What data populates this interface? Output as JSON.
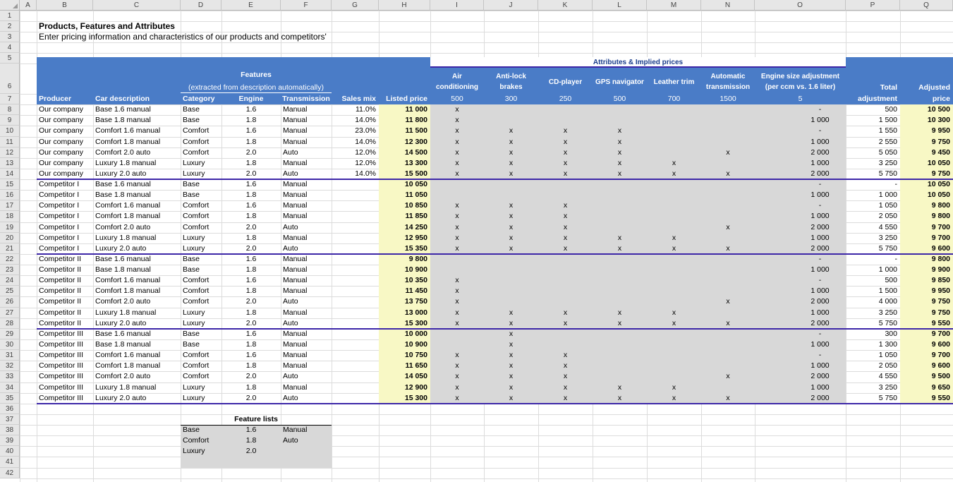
{
  "sheet": {
    "columns": [
      "A",
      "B",
      "C",
      "D",
      "E",
      "F",
      "G",
      "H",
      "I",
      "J",
      "K",
      "L",
      "M",
      "N",
      "O",
      "P",
      "Q"
    ],
    "title": "Products, Features and Attributes",
    "subtitle": "Enter pricing information and characteristics of our products and competitors'",
    "attributes_header": "Attributes & Implied prices",
    "features_header": "Features",
    "features_sub": "(extracted from description automatically)",
    "attr_headers": [
      "Air\nconditioning",
      "Anti-lock\nbrakes",
      "CD-player",
      "GPS navigator",
      "Leather trim",
      "Automatic\ntransmission",
      "Engine size adjustment\n(per ccm vs. 1.6 liter)"
    ],
    "attr_prices": [
      "500",
      "300",
      "250",
      "500",
      "700",
      "1500",
      "5"
    ],
    "total_header": "Total",
    "adjusted_header": "Adjusted",
    "col_labels": [
      "Producer",
      "Car description",
      "Category",
      "Engine",
      "Transmission",
      "Sales mix",
      "Listed price",
      "adjustment",
      "price"
    ],
    "rows": [
      [
        "Our company",
        "Base 1.6 manual",
        "Base",
        "1.6",
        "Manual",
        "11.0%",
        "11 000",
        "x",
        "",
        "",
        "",
        "",
        "",
        "-",
        "500",
        "10 500"
      ],
      [
        "Our company",
        "Base 1.8 manual",
        "Base",
        "1.8",
        "Manual",
        "14.0%",
        "11 800",
        "x",
        "",
        "",
        "",
        "",
        "",
        "1 000",
        "1 500",
        "10 300"
      ],
      [
        "Our company",
        "Comfort 1.6 manual",
        "Comfort",
        "1.6",
        "Manual",
        "23.0%",
        "11 500",
        "x",
        "x",
        "x",
        "x",
        "",
        "",
        "-",
        "1 550",
        "9 950"
      ],
      [
        "Our company",
        "Comfort 1.8 manual",
        "Comfort",
        "1.8",
        "Manual",
        "14.0%",
        "12 300",
        "x",
        "x",
        "x",
        "x",
        "",
        "",
        "1 000",
        "2 550",
        "9 750"
      ],
      [
        "Our company",
        "Comfort 2.0 auto",
        "Comfort",
        "2.0",
        "Auto",
        "12.0%",
        "14 500",
        "x",
        "x",
        "x",
        "x",
        "",
        "x",
        "2 000",
        "5 050",
        "9 450"
      ],
      [
        "Our company",
        "Luxury 1.8 manual",
        "Luxury",
        "1.8",
        "Manual",
        "12.0%",
        "13 300",
        "x",
        "x",
        "x",
        "x",
        "x",
        "",
        "1 000",
        "3 250",
        "10 050"
      ],
      [
        "Our company",
        "Luxury 2.0 auto",
        "Luxury",
        "2.0",
        "Auto",
        "14.0%",
        "15 500",
        "x",
        "x",
        "x",
        "x",
        "x",
        "x",
        "2 000",
        "5 750",
        "9 750"
      ],
      [
        "Competitor I",
        "Base 1.6 manual",
        "Base",
        "1.6",
        "Manual",
        "",
        "10 050",
        "",
        "",
        "",
        "",
        "",
        "",
        "-",
        "-",
        "10 050"
      ],
      [
        "Competitor I",
        "Base 1.8 manual",
        "Base",
        "1.8",
        "Manual",
        "",
        "11 050",
        "",
        "",
        "",
        "",
        "",
        "",
        "1 000",
        "1 000",
        "10 050"
      ],
      [
        "Competitor I",
        "Comfort 1.6 manual",
        "Comfort",
        "1.6",
        "Manual",
        "",
        "10 850",
        "x",
        "x",
        "x",
        "",
        "",
        "",
        "-",
        "1 050",
        "9 800"
      ],
      [
        "Competitor I",
        "Comfort 1.8 manual",
        "Comfort",
        "1.8",
        "Manual",
        "",
        "11 850",
        "x",
        "x",
        "x",
        "",
        "",
        "",
        "1 000",
        "2 050",
        "9 800"
      ],
      [
        "Competitor I",
        "Comfort 2.0 auto",
        "Comfort",
        "2.0",
        "Auto",
        "",
        "14 250",
        "x",
        "x",
        "x",
        "",
        "",
        "x",
        "2 000",
        "4 550",
        "9 700"
      ],
      [
        "Competitor I",
        "Luxury 1.8 manual",
        "Luxury",
        "1.8",
        "Manual",
        "",
        "12 950",
        "x",
        "x",
        "x",
        "x",
        "x",
        "",
        "1 000",
        "3 250",
        "9 700"
      ],
      [
        "Competitor I",
        "Luxury 2.0 auto",
        "Luxury",
        "2.0",
        "Auto",
        "",
        "15 350",
        "x",
        "x",
        "x",
        "x",
        "x",
        "x",
        "2 000",
        "5 750",
        "9 600"
      ],
      [
        "Competitor II",
        "Base 1.6 manual",
        "Base",
        "1.6",
        "Manual",
        "",
        "9 800",
        "",
        "",
        "",
        "",
        "",
        "",
        "-",
        "-",
        "9 800"
      ],
      [
        "Competitor II",
        "Base 1.8 manual",
        "Base",
        "1.8",
        "Manual",
        "",
        "10 900",
        "",
        "",
        "",
        "",
        "",
        "",
        "1 000",
        "1 000",
        "9 900"
      ],
      [
        "Competitor II",
        "Comfort 1.6 manual",
        "Comfort",
        "1.6",
        "Manual",
        "",
        "10 350",
        "x",
        "",
        "",
        "",
        "",
        "",
        "-",
        "500",
        "9 850"
      ],
      [
        "Competitor II",
        "Comfort 1.8 manual",
        "Comfort",
        "1.8",
        "Manual",
        "",
        "11 450",
        "x",
        "",
        "",
        "",
        "",
        "",
        "1 000",
        "1 500",
        "9 950"
      ],
      [
        "Competitor II",
        "Comfort 2.0 auto",
        "Comfort",
        "2.0",
        "Auto",
        "",
        "13 750",
        "x",
        "",
        "",
        "",
        "",
        "x",
        "2 000",
        "4 000",
        "9 750"
      ],
      [
        "Competitor II",
        "Luxury 1.8 manual",
        "Luxury",
        "1.8",
        "Manual",
        "",
        "13 000",
        "x",
        "x",
        "x",
        "x",
        "x",
        "",
        "1 000",
        "3 250",
        "9 750"
      ],
      [
        "Competitor II",
        "Luxury 2.0 auto",
        "Luxury",
        "2.0",
        "Auto",
        "",
        "15 300",
        "x",
        "x",
        "x",
        "x",
        "x",
        "x",
        "2 000",
        "5 750",
        "9 550"
      ],
      [
        "Competitor III",
        "Base 1.6 manual",
        "Base",
        "1.6",
        "Manual",
        "",
        "10 000",
        "",
        "x",
        "",
        "",
        "",
        "",
        "-",
        "300",
        "9 700"
      ],
      [
        "Competitor III",
        "Base 1.8 manual",
        "Base",
        "1.8",
        "Manual",
        "",
        "10 900",
        "",
        "x",
        "",
        "",
        "",
        "",
        "1 000",
        "1 300",
        "9 600"
      ],
      [
        "Competitor III",
        "Comfort 1.6 manual",
        "Comfort",
        "1.6",
        "Manual",
        "",
        "10 750",
        "x",
        "x",
        "x",
        "",
        "",
        "",
        "-",
        "1 050",
        "9 700"
      ],
      [
        "Competitor III",
        "Comfort 1.8 manual",
        "Comfort",
        "1.8",
        "Manual",
        "",
        "11 650",
        "x",
        "x",
        "x",
        "",
        "",
        "",
        "1 000",
        "2 050",
        "9 600"
      ],
      [
        "Competitor III",
        "Comfort 2.0 auto",
        "Comfort",
        "2.0",
        "Auto",
        "",
        "14 050",
        "x",
        "x",
        "x",
        "",
        "",
        "x",
        "2 000",
        "4 550",
        "9 500"
      ],
      [
        "Competitor III",
        "Luxury 1.8 manual",
        "Luxury",
        "1.8",
        "Manual",
        "",
        "12 900",
        "x",
        "x",
        "x",
        "x",
        "x",
        "",
        "1 000",
        "3 250",
        "9 650"
      ],
      [
        "Competitor III",
        "Luxury 2.0 auto",
        "Luxury",
        "2.0",
        "Auto",
        "",
        "15 300",
        "x",
        "x",
        "x",
        "x",
        "x",
        "x",
        "2 000",
        "5 750",
        "9 550"
      ]
    ],
    "feature_lists": {
      "title": "Feature lists",
      "rows": [
        [
          "Base",
          "1.6",
          "Manual"
        ],
        [
          "Comfort",
          "1.8",
          "Auto"
        ],
        [
          "Luxury",
          "2.0",
          ""
        ]
      ]
    }
  },
  "colors": {
    "header_blue": "#4a7cc7",
    "price_yellow": "#f8f8c5",
    "attr_gray": "#d8d8d8",
    "group_line": "#3d27a8"
  }
}
